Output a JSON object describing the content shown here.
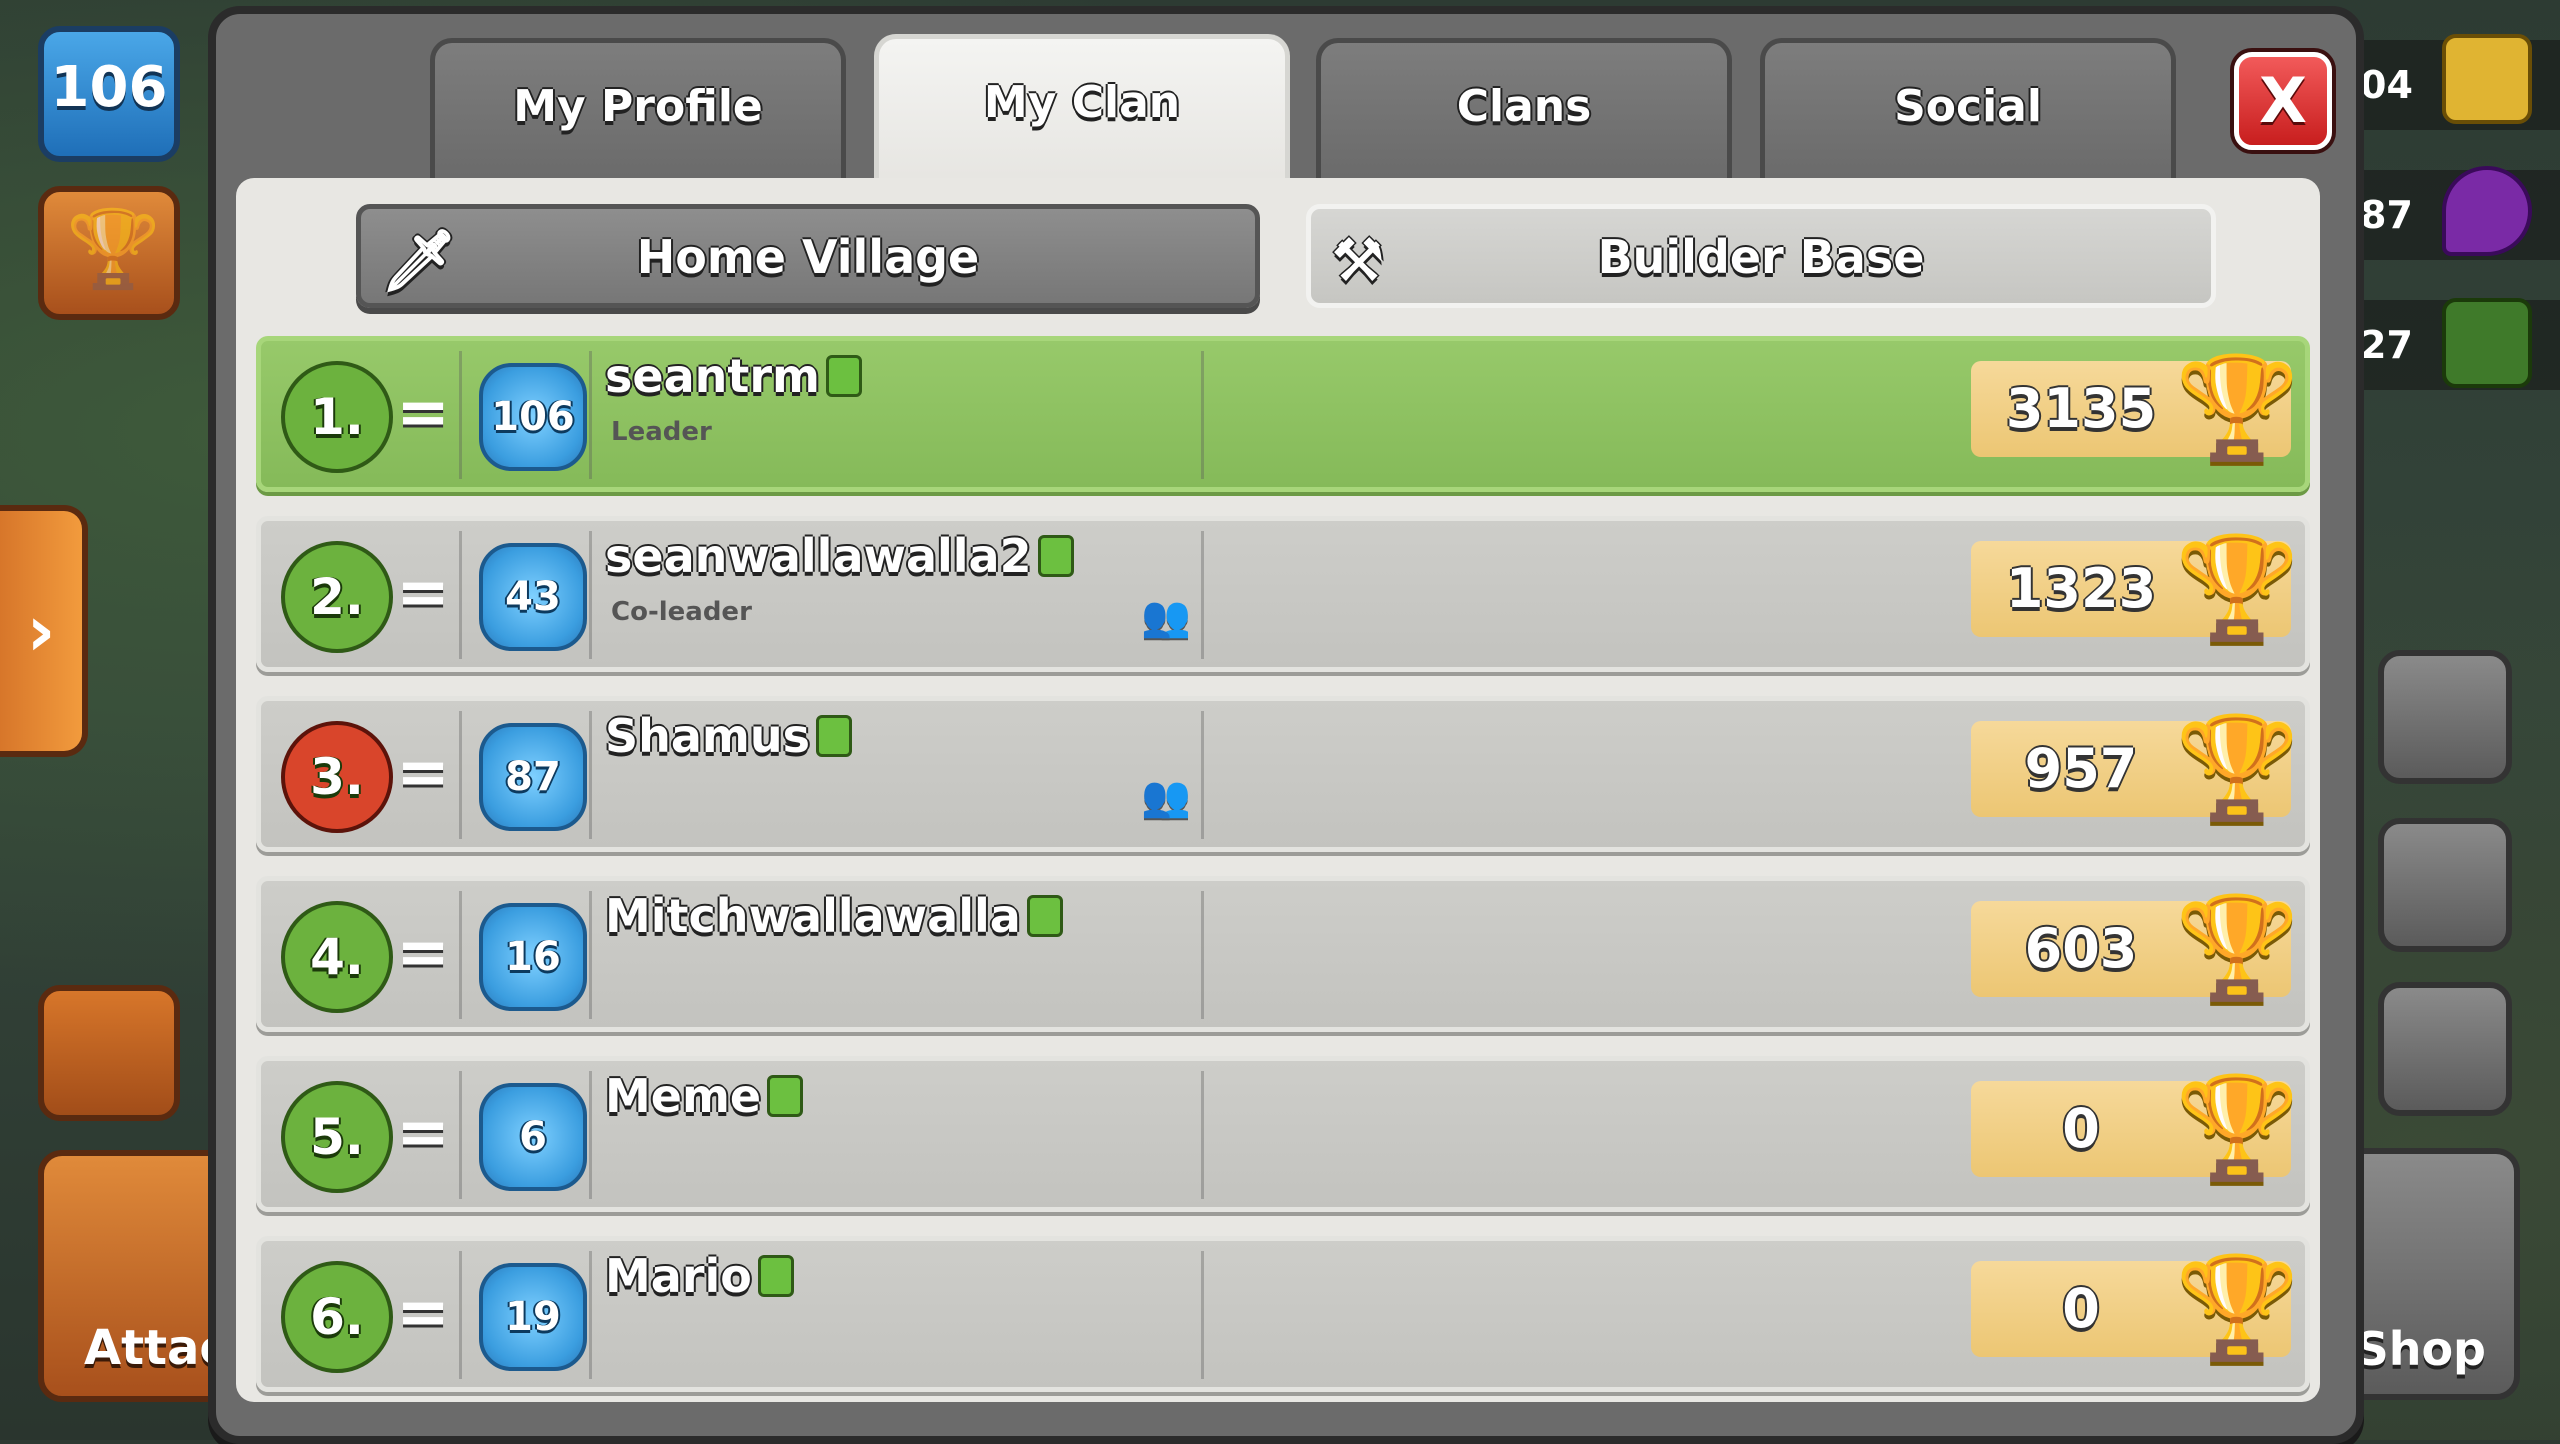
{
  "hud": {
    "level": "106",
    "attack_label": "Attac",
    "shop_label": "Shop",
    "resources": [
      {
        "value": "04",
        "color": "#e0b432",
        "icon": "gold-icon"
      },
      {
        "value": "87",
        "color": "#7a2aa6",
        "icon": "elixir-icon"
      },
      {
        "value": "27",
        "color": "#3f7a2a",
        "icon": "gem-icon"
      }
    ]
  },
  "window": {
    "tabs": [
      {
        "label": "My Profile",
        "active": false
      },
      {
        "label": "My Clan",
        "active": true
      },
      {
        "label": "Clans",
        "active": false
      },
      {
        "label": "Social",
        "active": false
      }
    ],
    "close_label": "X",
    "subtabs": {
      "home": "Home Village",
      "builder": "Builder Base"
    }
  },
  "members": [
    {
      "rank": "1.",
      "change": "=",
      "level": "106",
      "name": "seantrm",
      "role": "Leader",
      "trophies": "3135",
      "me": true,
      "friend": false,
      "badge": "green"
    },
    {
      "rank": "2.",
      "change": "=",
      "level": "43",
      "name": "seanwallawalla2",
      "role": "Co-leader",
      "trophies": "1323",
      "me": false,
      "friend": true,
      "badge": "green"
    },
    {
      "rank": "3.",
      "change": "=",
      "level": "87",
      "name": "Shamus",
      "role": "",
      "trophies": "957",
      "me": false,
      "friend": true,
      "badge": "red"
    },
    {
      "rank": "4.",
      "change": "=",
      "level": "16",
      "name": "Mitchwallawalla",
      "role": "",
      "trophies": "603",
      "me": false,
      "friend": false,
      "badge": "green"
    },
    {
      "rank": "5.",
      "change": "=",
      "level": "6",
      "name": "Meme",
      "role": "",
      "trophies": "0",
      "me": false,
      "friend": false,
      "badge": "green"
    },
    {
      "rank": "6.",
      "change": "=",
      "level": "19",
      "name": "Mario",
      "role": "",
      "trophies": "0",
      "me": false,
      "friend": false,
      "badge": "green"
    }
  ]
}
